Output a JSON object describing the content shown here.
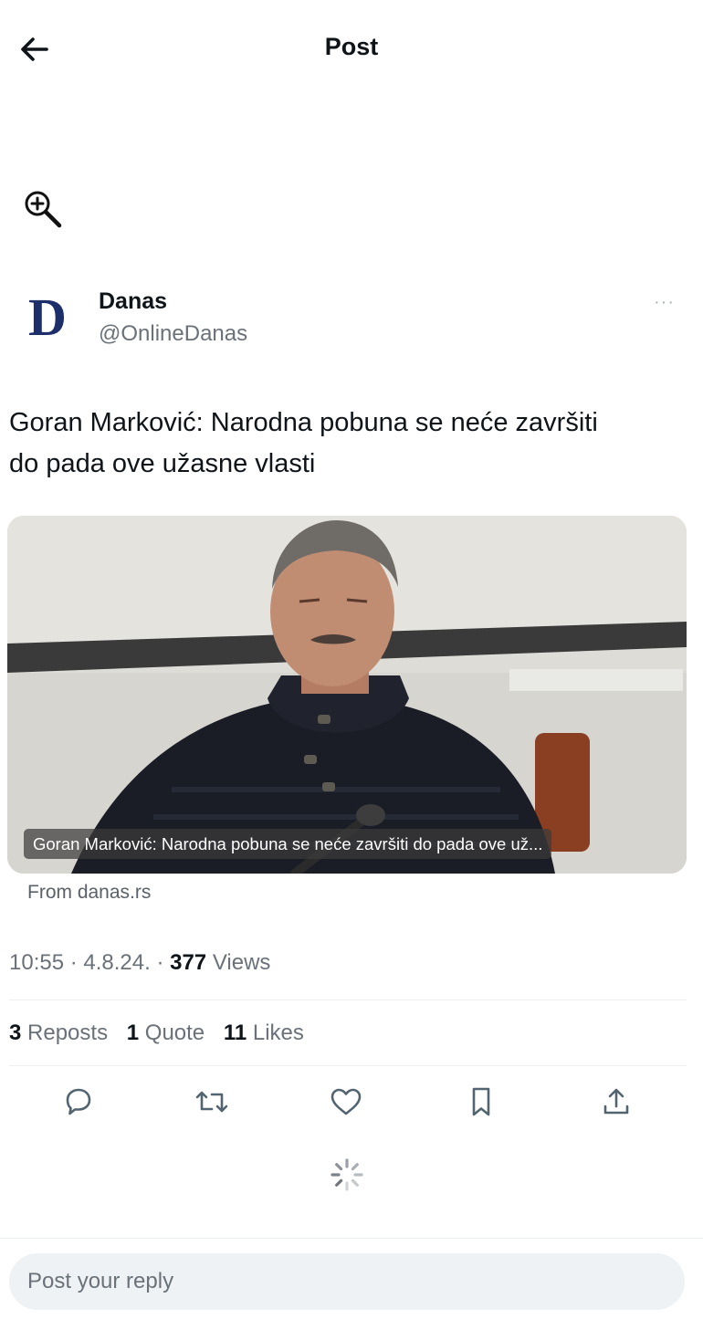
{
  "header": {
    "title": "Post"
  },
  "author": {
    "avatar_letter": "D",
    "name": "Danas",
    "handle": "@OnlineDanas"
  },
  "post": {
    "text_line1": "Goran Marković: Narodna pobuna se neće završiti",
    "text_line2": "do pada ove užasne vlasti",
    "card": {
      "caption": "Goran Marković: Narodna pobuna se neće završiti do pada ove už...",
      "source": "From danas.rs"
    },
    "meta": {
      "time_date": "10:55 · 4.8.24. · ",
      "views_count": "377",
      "views_label": " Views"
    },
    "stats": {
      "reposts_count": "3",
      "reposts_label": " Reposts",
      "quotes_count": "1",
      "quotes_label": " Quote",
      "likes_count": "11",
      "likes_label": " Likes"
    }
  },
  "reply": {
    "placeholder": "Post your reply"
  },
  "colors": {
    "text": "#0f1419",
    "secondary": "#6a7179",
    "icon": "#536471",
    "avatar_navy": "#1d2f6b"
  }
}
